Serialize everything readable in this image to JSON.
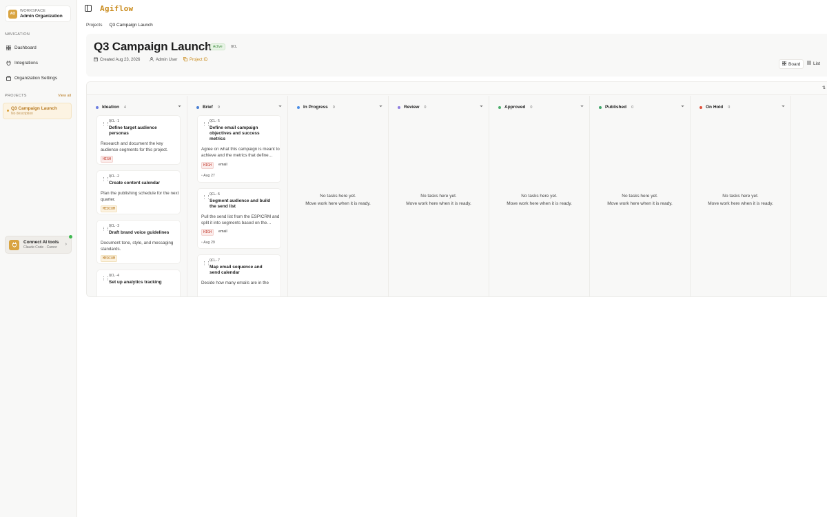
{
  "sidebar": {
    "workspace_label": "WORKSPACE",
    "workspace_name": "Admin Organization",
    "workspace_initials": "AO",
    "nav_heading": "NAVIGATION",
    "nav_items": [
      {
        "label": "Dashboard",
        "icon": "grid-icon"
      },
      {
        "label": "Integrations",
        "icon": "plug-icon"
      },
      {
        "label": "Organization Settings",
        "icon": "building-icon"
      }
    ],
    "projects_heading": "PROJECTS",
    "view_all": "View all",
    "project": {
      "title": "Q3 Campaign Launch",
      "desc": "No description"
    },
    "ai": {
      "title": "Connect AI tools",
      "subtitle": "Claude Code · Cursor",
      "icon": "plug-icon"
    }
  },
  "topbar": {
    "logo": "Agiflow"
  },
  "breadcrumb": [
    "Projects",
    "Q3 Campaign Launch"
  ],
  "header": {
    "title": "Q3 Campaign Launch",
    "status": "Active",
    "code": "QCL",
    "created": "Created Aug 23, 2026",
    "user": "Admin User",
    "project_id": "Project ID",
    "views": [
      "Board",
      "List"
    ]
  },
  "board": {
    "empty_line1": "No tasks here yet.",
    "empty_line2": "Move work here when it is ready.",
    "columns": [
      {
        "name": "Ideation",
        "count": "4",
        "color": "#6b7de0"
      },
      {
        "name": "Brief",
        "count": "9",
        "color": "#4a7fd4"
      },
      {
        "name": "In Progress",
        "count": "0",
        "color": "#4b8ee6"
      },
      {
        "name": "Review",
        "count": "0",
        "color": "#8e7de0"
      },
      {
        "name": "Approved",
        "count": "0",
        "color": "#4caf6d"
      },
      {
        "name": "Published",
        "count": "0",
        "color": "#3fa66b"
      },
      {
        "name": "On Hold",
        "count": "0",
        "color": "#e0533c"
      }
    ],
    "ideation_cards": [
      {
        "id": "QCL-1",
        "title": "Define target audience personas",
        "desc": "Research and document the key audience segments for this project.",
        "priority": "HIGH"
      },
      {
        "id": "QCL-2",
        "title": "Create content calendar",
        "desc": "Plan the publishing schedule for the next quarter.",
        "priority": "MEDIUM"
      },
      {
        "id": "QCL-3",
        "title": "Draft brand voice guidelines",
        "desc": "Document tone, style, and messaging standards.",
        "priority": "MEDIUM"
      },
      {
        "id": "QCL-4",
        "title": "Set up analytics tracking"
      }
    ],
    "brief_cards": [
      {
        "id": "QCL-5",
        "title": "Define email campaign objectives and success metrics",
        "desc": "Agree on what this campaign is meant to achieve and the metrics that define…",
        "priority": "HIGH",
        "tag": "email",
        "due": "Aug 27"
      },
      {
        "id": "QCL-6",
        "title": "Segment audience and build the send list",
        "desc": "Pull the send list from the ESP/CRM and split it into segments based on the…",
        "priority": "HIGH",
        "tag": "email",
        "due": "Aug 29"
      },
      {
        "id": "QCL-7",
        "title": "Map email sequence and send calendar",
        "desc": "Decide how many emails are in the"
      }
    ]
  },
  "colors": {
    "accent": "#c98a1b",
    "high": "#c0392b",
    "medium": "#b7791f"
  }
}
